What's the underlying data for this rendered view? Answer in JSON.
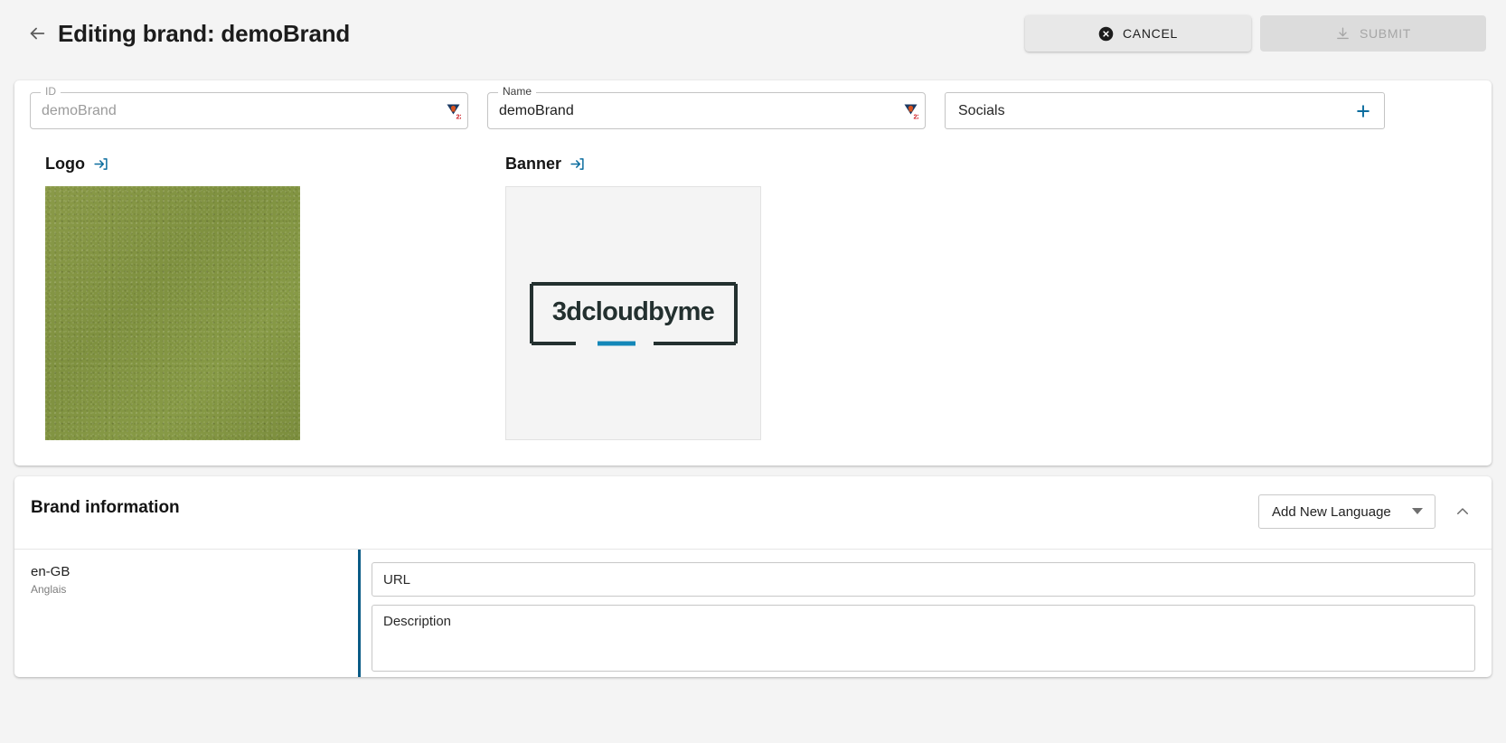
{
  "header": {
    "back_icon": "arrow-left-icon",
    "title": "Editing brand: demoBrand",
    "cancel_label": "CANCEL",
    "cancel_icon": "cancel-circle-icon",
    "submit_label": "SUBMIT",
    "submit_icon": "save-download-icon",
    "submit_disabled": true
  },
  "form": {
    "id_field": {
      "legend": "ID",
      "value": "demoBrand",
      "disabled": true,
      "extension_icon": "lastpass-vault-icon",
      "extension_badge": "22"
    },
    "name_field": {
      "legend": "Name",
      "value": "demoBrand",
      "extension_icon": "lastpass-vault-icon",
      "extension_badge": "22"
    },
    "socials_field": {
      "label": "Socials",
      "add_icon": "plus-icon",
      "add_color": "#0a6c9e"
    }
  },
  "media": {
    "logo": {
      "heading": "Logo",
      "upload_icon": "upload-into-box-icon",
      "image_alt": "green fabric texture swatch",
      "swatch_color": "#7f9140"
    },
    "banner": {
      "heading": "Banner",
      "upload_icon": "upload-into-box-icon",
      "image_alt": "3dcloudbyme wordmark logo",
      "wordmark": "3dcloudbyme",
      "frame_color": "#23302f",
      "accent_color": "#1387b8"
    }
  },
  "brand_information": {
    "title": "Brand information",
    "add_language_label": "Add New Language",
    "add_language_caret": "chevron-down-icon",
    "collapse_icon": "chevron-up-icon",
    "accent_color": "#0a5b86",
    "languages": [
      {
        "code": "en-GB",
        "name": "Anglais",
        "url_placeholder": "URL",
        "url_value": "",
        "description_placeholder": "Description",
        "description_value": ""
      }
    ]
  }
}
